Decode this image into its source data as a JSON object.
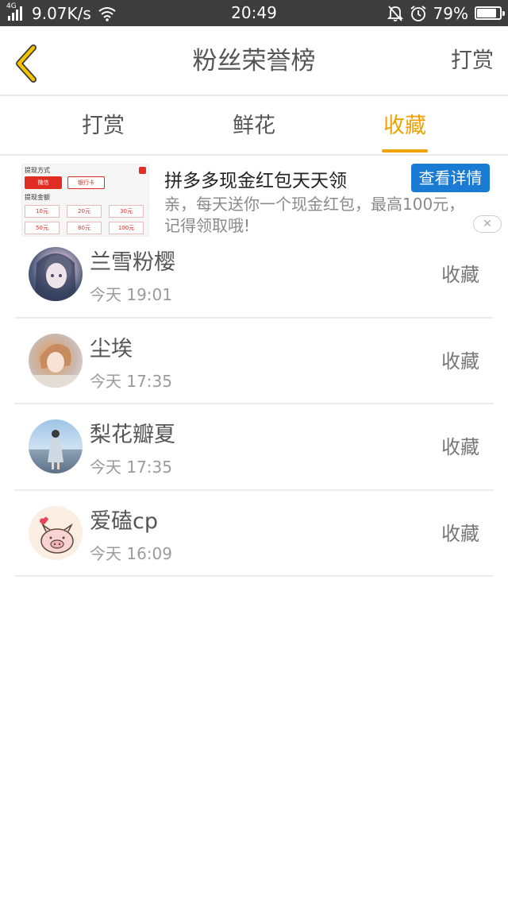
{
  "status_bar": {
    "network": "4G",
    "speed": "9.07K/s",
    "time": "20:49",
    "battery": "79%",
    "battery_level": 0.79,
    "icons": [
      "signal-icon",
      "wifi-icon",
      "bell-muted-icon",
      "alarm-icon",
      "battery-icon"
    ]
  },
  "header": {
    "title": "粉丝荣誉榜",
    "action": "打赏",
    "back_icon": "chevron-left-icon",
    "back_color": "#f3c200"
  },
  "tabs": [
    {
      "label": "打赏",
      "active": false
    },
    {
      "label": "鲜花",
      "active": false
    },
    {
      "label": "收藏",
      "active": true
    }
  ],
  "accent_color": "#f0a300",
  "ad": {
    "thumb": {
      "label_method": "提现方式",
      "wechat": "微信",
      "bank": "银行卡",
      "label_amount": "提现金额",
      "amounts": [
        "10元",
        "20元",
        "30元",
        "50元",
        "80元",
        "100元"
      ]
    },
    "title": "拼多多现金红包天天领",
    "button": "查看详情",
    "description": "亲，每天送你一个现金红包，最高100元，记得领取哦!",
    "close_icon": "close-icon",
    "button_color": "#1a7bd4"
  },
  "list": [
    {
      "name": "兰雪粉樱",
      "time": "今天 19:01",
      "action": "收藏"
    },
    {
      "name": "尘埃",
      "time": "今天 17:35",
      "action": "收藏"
    },
    {
      "name": "梨花瓣夏",
      "time": "今天 17:35",
      "action": "收藏"
    },
    {
      "name": "爱磕cp",
      "time": "今天 16:09",
      "action": "收藏"
    }
  ]
}
